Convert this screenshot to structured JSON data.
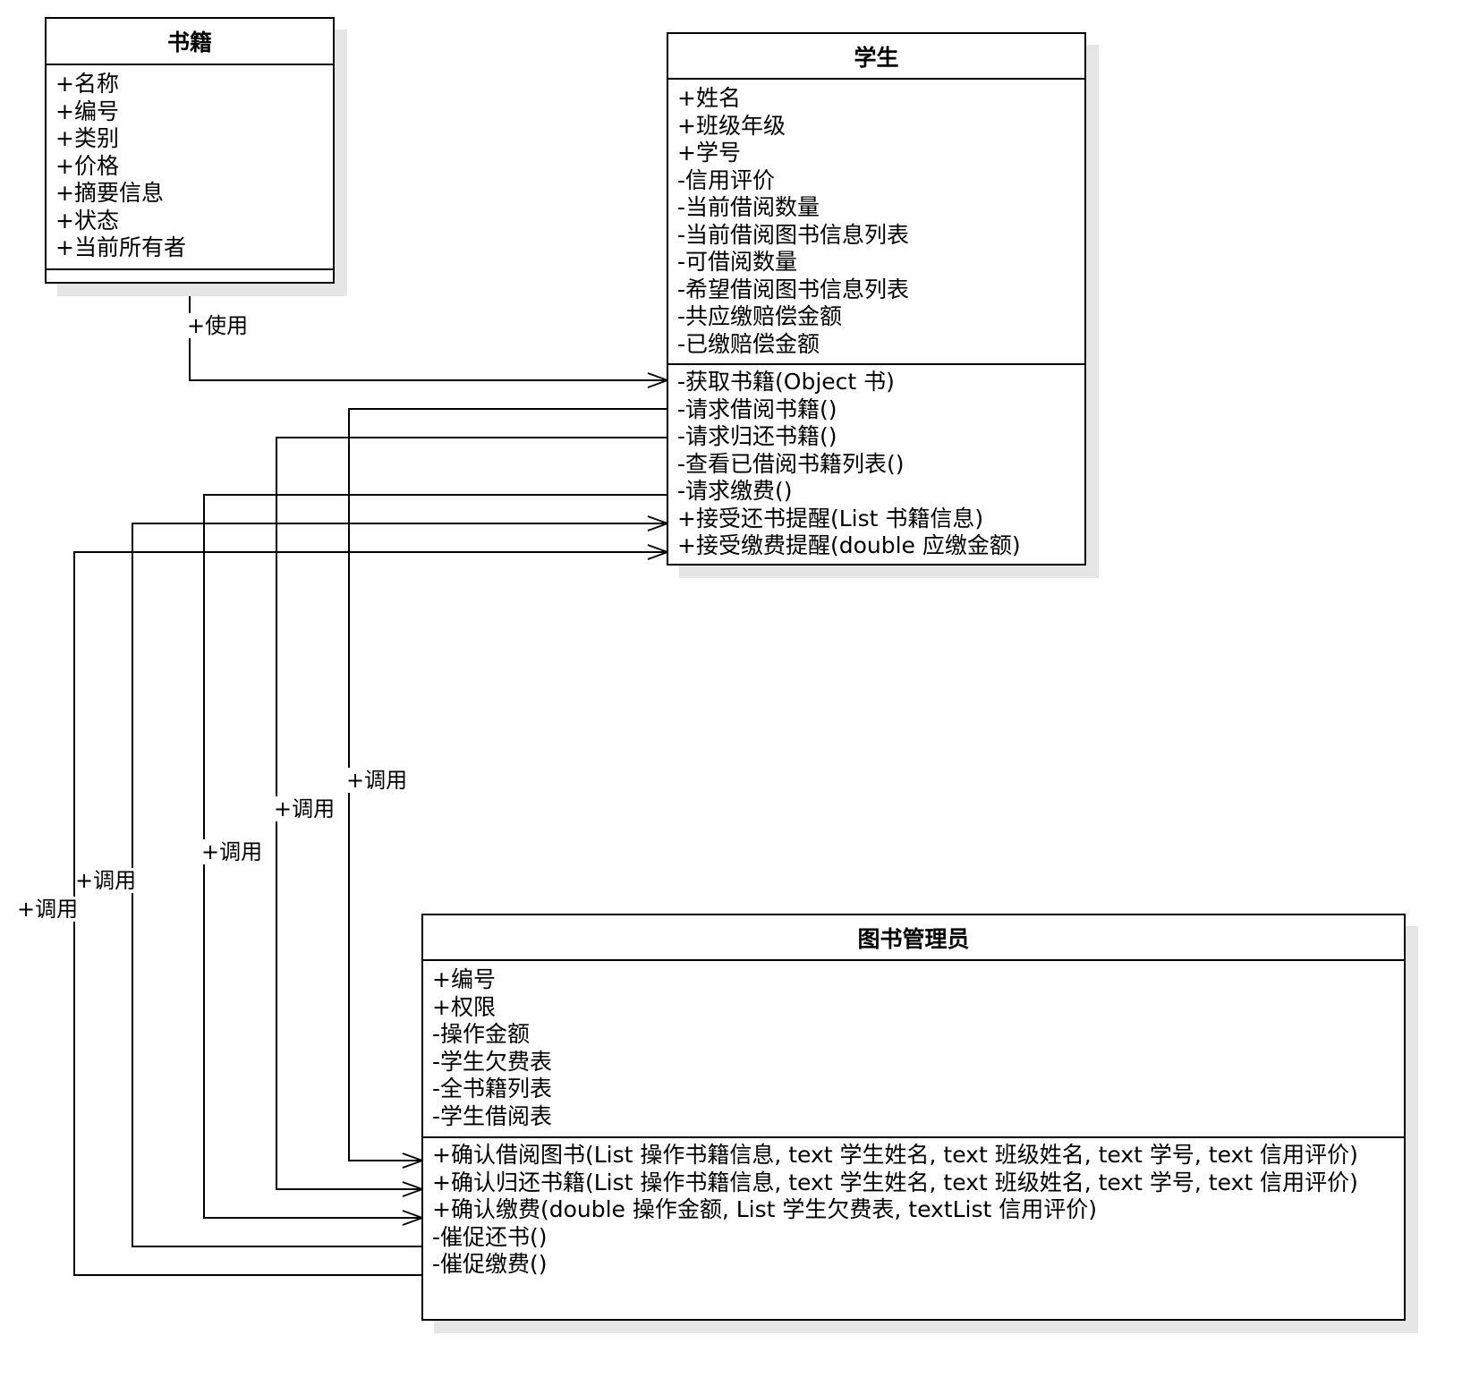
{
  "classes": {
    "book": {
      "title": "书籍",
      "attributes": [
        "+名称",
        "+编号",
        "+类别",
        "+价格",
        "+摘要信息",
        "+状态",
        "+当前所有者"
      ],
      "methods": []
    },
    "student": {
      "title": "学生",
      "attributes": [
        "+姓名",
        "+班级年级",
        "+学号",
        "-信用评价",
        "-当前借阅数量",
        "-当前借阅图书信息列表",
        "-可借阅数量",
        "-希望借阅图书信息列表",
        "-共应缴赔偿金额",
        "-已缴赔偿金额"
      ],
      "methods": [
        "-获取书籍(Object 书)",
        "-请求借阅书籍()",
        "-请求归还书籍()",
        "-查看已借阅书籍列表()",
        "-请求缴费()",
        "+接受还书提醒(List 书籍信息)",
        "+接受缴费提醒(double 应缴金额)"
      ]
    },
    "librarian": {
      "title": "图书管理员",
      "attributes": [
        "+编号",
        "+权限",
        "-操作金额",
        "-学生欠费表",
        "-全书籍列表",
        "-学生借阅表"
      ],
      "methods": [
        "+确认借阅图书(List 操作书籍信息, text 学生姓名, text 班级姓名, text 学号, text 信用评价)",
        "+确认归还书籍(List 操作书籍信息, text 学生姓名, text 班级姓名, text 学号, text 信用评价)",
        "+确认缴费(double 操作金额, List 学生欠费表, textList 信用评价)",
        "-催促还书()",
        "-催促缴费()"
      ]
    }
  },
  "edges": [
    {
      "from": "book",
      "to": "student.method.0",
      "label": "+使用"
    },
    {
      "from": "student.method.1",
      "to": "librarian.method.0",
      "label": "+调用"
    },
    {
      "from": "student.method.2",
      "to": "librarian.method.1",
      "label": "+调用"
    },
    {
      "from": "student.method.4",
      "to": "librarian.method.2",
      "label": "+调用"
    },
    {
      "from": "librarian.method.3",
      "to": "student.method.5",
      "label": "+调用"
    },
    {
      "from": "librarian.method.4",
      "to": "student.method.6",
      "label": "+调用"
    }
  ]
}
